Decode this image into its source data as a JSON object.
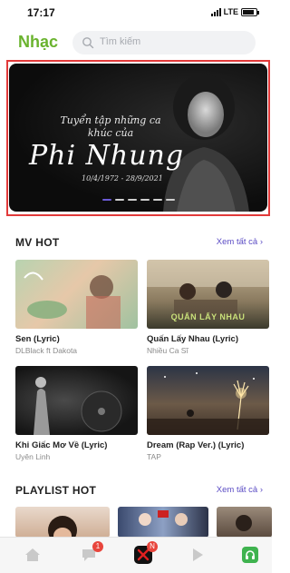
{
  "status_bar": {
    "time": "17:17",
    "network": "LTE"
  },
  "header": {
    "title": "Nhạc",
    "search_placeholder": "Tìm kiếm"
  },
  "banner": {
    "subtitle": "Tuyển tập những ca khúc của",
    "name": "Phi Nhung",
    "dates": "10/4/1972 - 28/9/2021",
    "slide_count": 6,
    "active_slide": 1
  },
  "mv_hot": {
    "title": "MV HOT",
    "see_all": "Xem tất cả",
    "items": [
      {
        "title": "Sen (Lyric)",
        "artist": "DLBlack ft Dakota"
      },
      {
        "title": "Quấn Lấy Nhau (Lyric)",
        "artist": "Nhiều Ca Sĩ",
        "thumb_text": "QUẤN LẤY NHAU"
      },
      {
        "title": "Khi Giấc Mơ Về (Lyric)",
        "artist": "Uyên Linh"
      },
      {
        "title": "Dream (Rap Ver.) (Lyric)",
        "artist": "TAP"
      }
    ]
  },
  "playlist_hot": {
    "title": "PLAYLIST HOT",
    "see_all": "Xem tất cả"
  },
  "nav": {
    "messages_badge": "1",
    "center_badge": "N"
  },
  "colors": {
    "brand_green": "#6ab32e",
    "link_purple": "#5b4cc4",
    "highlight_red": "#e23a3a",
    "badge_red": "#e8453c"
  }
}
